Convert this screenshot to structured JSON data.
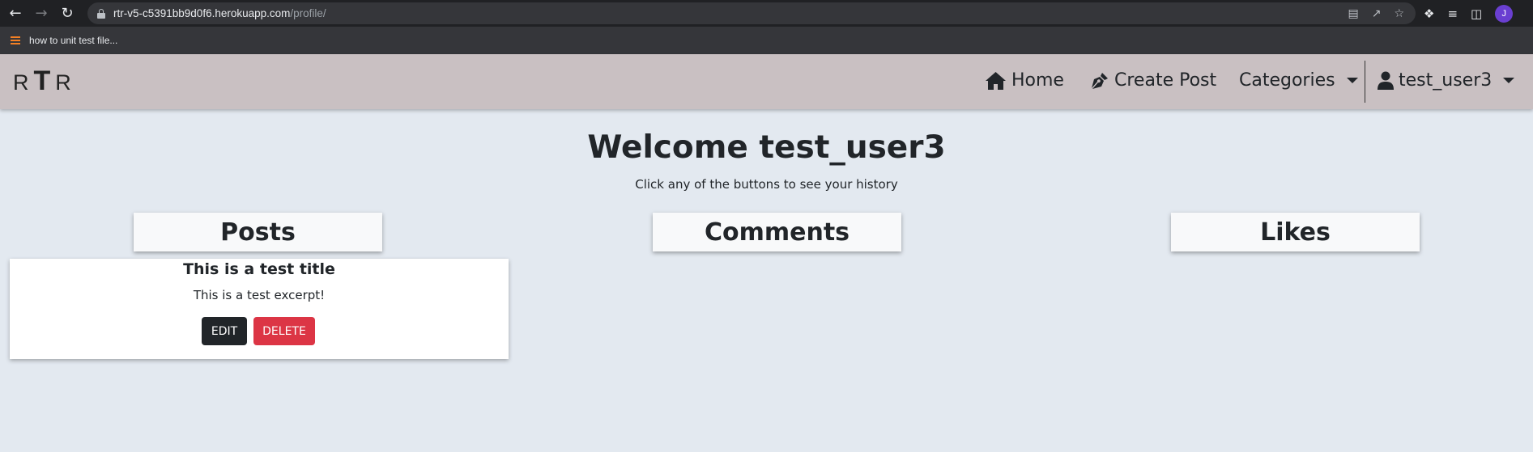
{
  "browser": {
    "url_host": "rtr-v5-c5391bb9d0f6.herokuapp.com",
    "url_path": "/profile/",
    "profile_initial": "J",
    "bookmark_label": "how to unit test file..."
  },
  "navbar": {
    "brand_left": "R",
    "brand_mid": "T",
    "brand_right": "R",
    "home": "Home",
    "create_post": "Create Post",
    "categories": "Categories",
    "user": "test_user3"
  },
  "main": {
    "welcome": "Welcome test_user3",
    "subtitle": "Click any of the buttons to see your history",
    "tabs": {
      "posts": "Posts",
      "comments": "Comments",
      "likes": "Likes"
    },
    "post": {
      "title": "This is a test title",
      "excerpt": "This is a test excerpt!",
      "edit_label": "EDIT",
      "delete_label": "DELETE"
    }
  },
  "colors": {
    "navbar_bg": "#c9c0c2",
    "page_bg": "#e3e9f0",
    "edit_btn": "#212529",
    "delete_btn": "#dc3545"
  }
}
